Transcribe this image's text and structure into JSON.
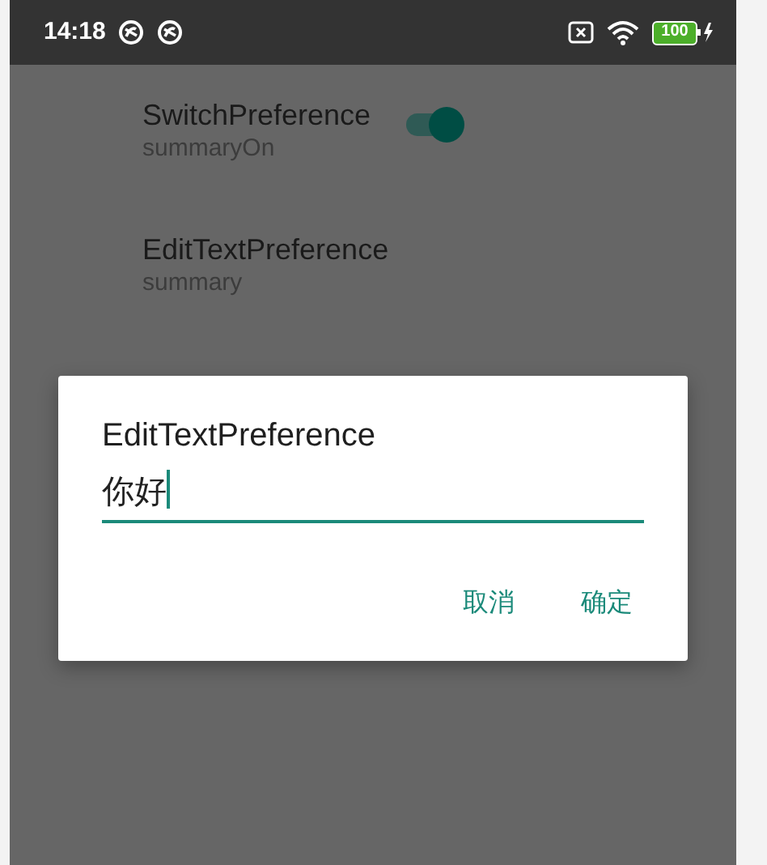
{
  "status_bar": {
    "time": "14:18",
    "battery": "100"
  },
  "preferences": [
    {
      "kind": "switch",
      "title": "SwitchPreference",
      "summary": "summaryOn",
      "checked": true
    },
    {
      "kind": "text",
      "title": "EditTextPreference",
      "summary": "summary"
    }
  ],
  "dialog": {
    "title": "EditTextPreference",
    "value": "你好",
    "buttons": [
      "取消",
      "确定"
    ]
  }
}
